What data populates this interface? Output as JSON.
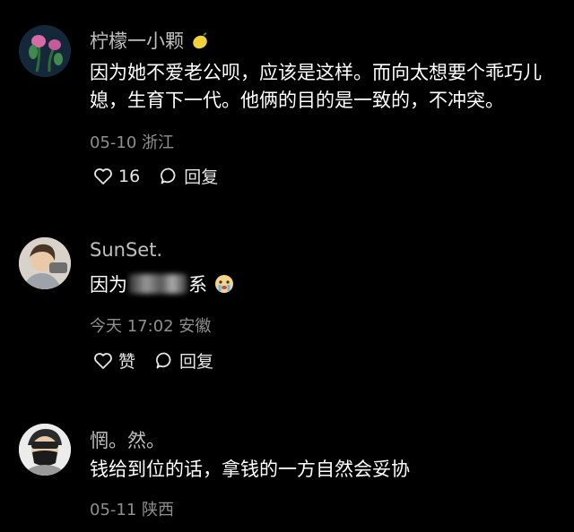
{
  "comments": [
    {
      "username": "柠檬一小颗",
      "username_emoji": "lemon-icon",
      "text": "因为她不爱老公呗，应该是这样。而向太想要个乖巧儿媳，生育下一代。他俩的目的是一致的，不冲突。",
      "date": "05-10",
      "location": "浙江",
      "like_count": "16",
      "reply_label": "回复"
    },
    {
      "username": "SunSet.",
      "text_prefix": "因为",
      "text_suffix": "系",
      "text_emoji": "cry-face-icon",
      "date": "今天 17:02",
      "location": "安徽",
      "like_label": "赞",
      "reply_label": "回复"
    },
    {
      "username": "惘。然。",
      "text": "钱给到位的话，拿钱的一方自然会妥协",
      "date": "05-11",
      "location": "陕西"
    }
  ],
  "colors": {
    "background": "#000000",
    "username": "#bfbfbf",
    "meta": "#8f8f8f",
    "text": "#ffffff"
  }
}
